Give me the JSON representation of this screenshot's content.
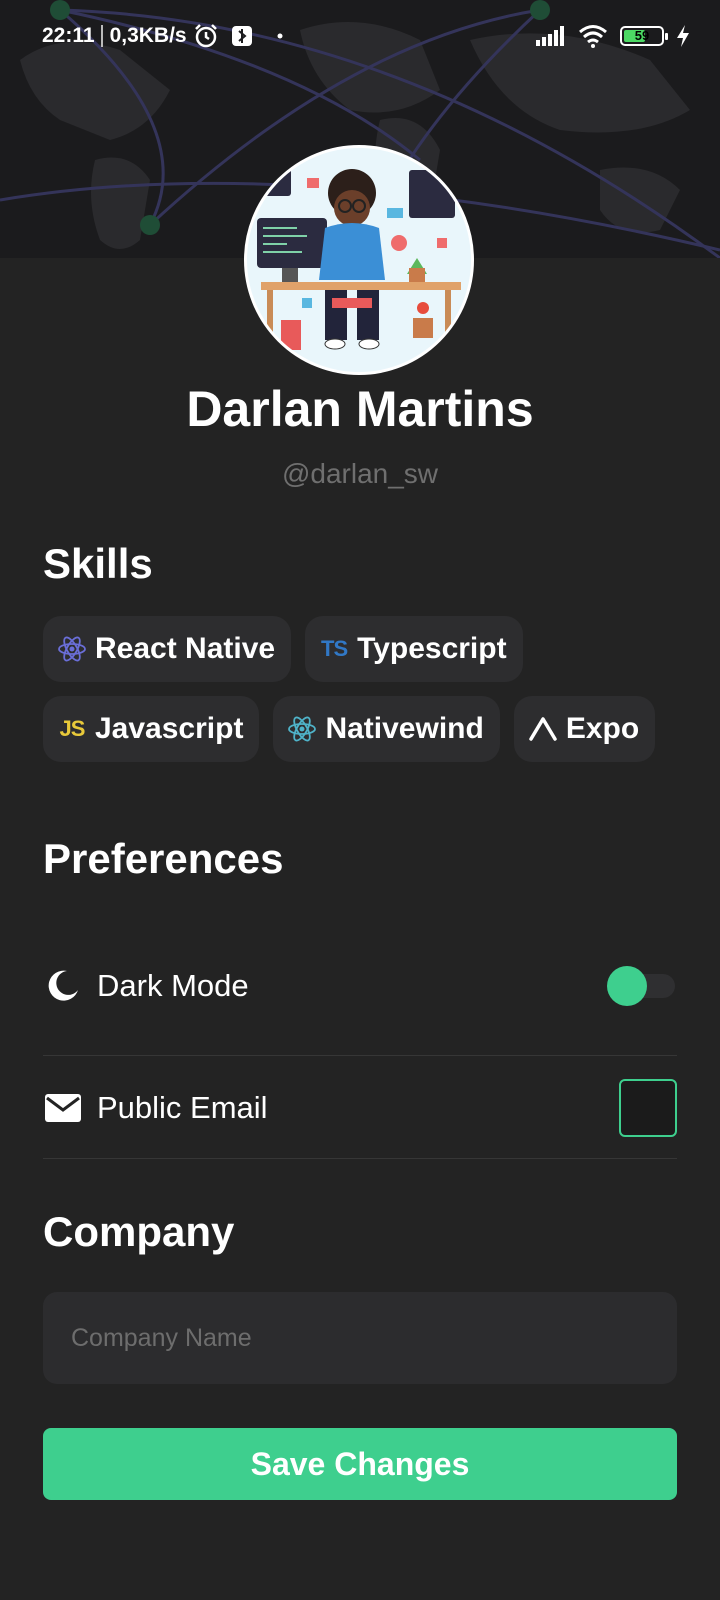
{
  "status_bar": {
    "time": "22:11",
    "speed": "0,3KB/s",
    "battery": "59",
    "icons": [
      "alarm-icon",
      "notification-app-icon",
      "dot-icon",
      "signal-icon",
      "wifi-icon",
      "battery-icon",
      "charging-icon"
    ]
  },
  "profile": {
    "name": "Darlan Martins",
    "handle": "@darlan_sw"
  },
  "skills": {
    "title": "Skills",
    "items": [
      {
        "label": "React Native",
        "icon": "react-icon"
      },
      {
        "label": "Typescript",
        "icon": "typescript-icon",
        "icon_text": "TS"
      },
      {
        "label": "Javascript",
        "icon": "javascript-icon",
        "icon_text": "JS"
      },
      {
        "label": "Nativewind",
        "icon": "react-icon"
      },
      {
        "label": "Expo",
        "icon": "expo-icon"
      }
    ]
  },
  "preferences": {
    "title": "Preferences",
    "dark_mode": {
      "label": "Dark Mode",
      "icon": "moon-icon",
      "enabled": true
    },
    "public_email": {
      "label": "Public Email",
      "icon": "mail-icon",
      "checked": false
    }
  },
  "company": {
    "title": "Company",
    "placeholder": "Company Name",
    "value": ""
  },
  "actions": {
    "save_label": "Save Changes"
  },
  "colors": {
    "accent": "#3ecf8e",
    "background": "#232323",
    "chip": "#2d2d2f"
  }
}
